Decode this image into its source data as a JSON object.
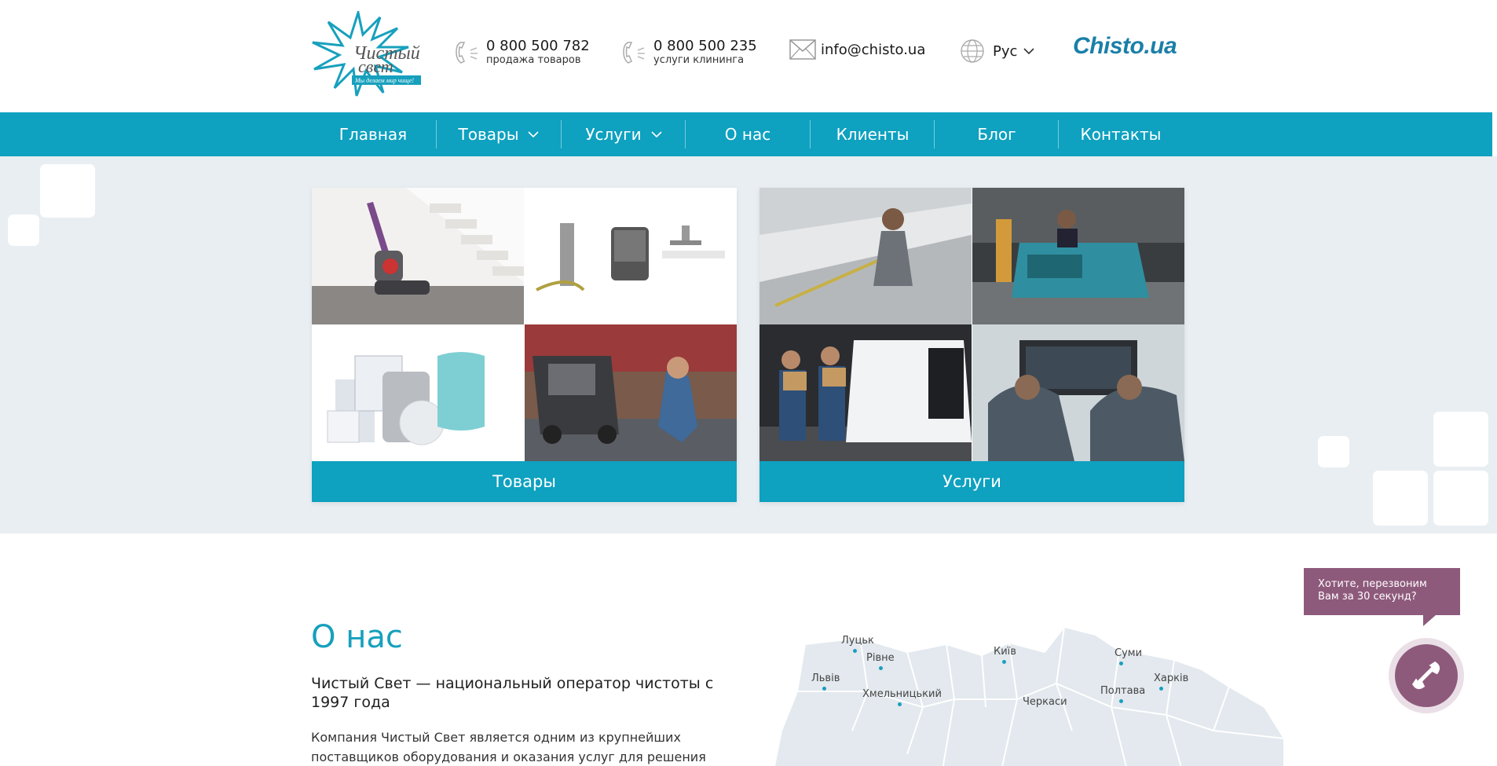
{
  "header": {
    "logo": {
      "line1": "Чистый",
      "line2": "свет",
      "tagline": "Мы делаем мир чище!"
    },
    "phones": [
      {
        "number": "0 800 500 782",
        "caption": "продажа товаров",
        "icon": "phone-icon"
      },
      {
        "number": "0 800 500 235",
        "caption": "услуги клининга",
        "icon": "phone-icon"
      }
    ],
    "email": {
      "address": "info@chisto.ua",
      "icon": "mail-icon"
    },
    "language": {
      "current": "Рус",
      "icon": "globe-icon"
    },
    "brand": "Chisto.ua"
  },
  "nav": {
    "items": [
      {
        "label": "Главная",
        "has_dropdown": false
      },
      {
        "label": "Товары",
        "has_dropdown": true
      },
      {
        "label": "Услуги",
        "has_dropdown": true
      },
      {
        "label": "О нас",
        "has_dropdown": false
      },
      {
        "label": "Клиенты",
        "has_dropdown": false
      },
      {
        "label": "Блог",
        "has_dropdown": false
      },
      {
        "label": "Контакты",
        "has_dropdown": false
      }
    ]
  },
  "hero": {
    "cards": [
      {
        "label": "Товары",
        "images": [
          "vacuum-cleaner-photo",
          "hand-dryers-photo",
          "hygiene-dispensers-photo",
          "pressure-washer-photo"
        ]
      },
      {
        "label": "Услуги",
        "images": [
          "escalator-cleaning-photo",
          "floor-scrubber-photo",
          "delivery-team-photo",
          "technicians-photo"
        ]
      }
    ]
  },
  "about": {
    "title": "О нас",
    "lead": "Чистый Свет — национальный оператор чистоты с 1997 года",
    "text": "Компания Чистый Свет является одним из крупнейших поставщиков оборудования и оказания услуг для решения"
  },
  "map": {
    "cities": [
      "Луцьк",
      "Рівне",
      "Львів",
      "Хмельницький",
      "Київ",
      "Суми",
      "Харків",
      "Полтава",
      "Черкаси"
    ]
  },
  "callback": {
    "text": "Хотите, перезвоним Вам за 30 секунд?",
    "icon": "phone-handset-icon"
  },
  "colors": {
    "accent": "#0ea1c0",
    "callback": "#8e5a7c",
    "hero_bg": "#e8eef2",
    "brand": "#1b7fa8"
  }
}
